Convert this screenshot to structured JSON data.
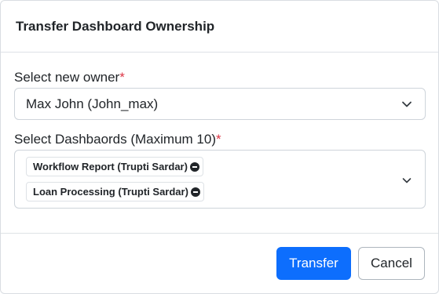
{
  "dialog": {
    "title": "Transfer Dashboard Ownership"
  },
  "owner_field": {
    "label": "Select new owner",
    "required_marker": "*",
    "value": "Max John (John_max)",
    "icon": "chevron-down-icon"
  },
  "dashboards_field": {
    "label": "Select Dashbaords (Maximum 10)",
    "required_marker": "*",
    "selected": [
      {
        "label": "Workflow Report (Trupti Sardar)"
      },
      {
        "label": "Loan Processing (Trupti Sardar)"
      }
    ],
    "icon": "chevron-down-icon",
    "remove_icon": "minus-circle-icon"
  },
  "footer": {
    "transfer_label": "Transfer",
    "cancel_label": "Cancel"
  },
  "colors": {
    "primary": "#0d6efd",
    "required": "#dc3545",
    "border": "#ced4da"
  }
}
